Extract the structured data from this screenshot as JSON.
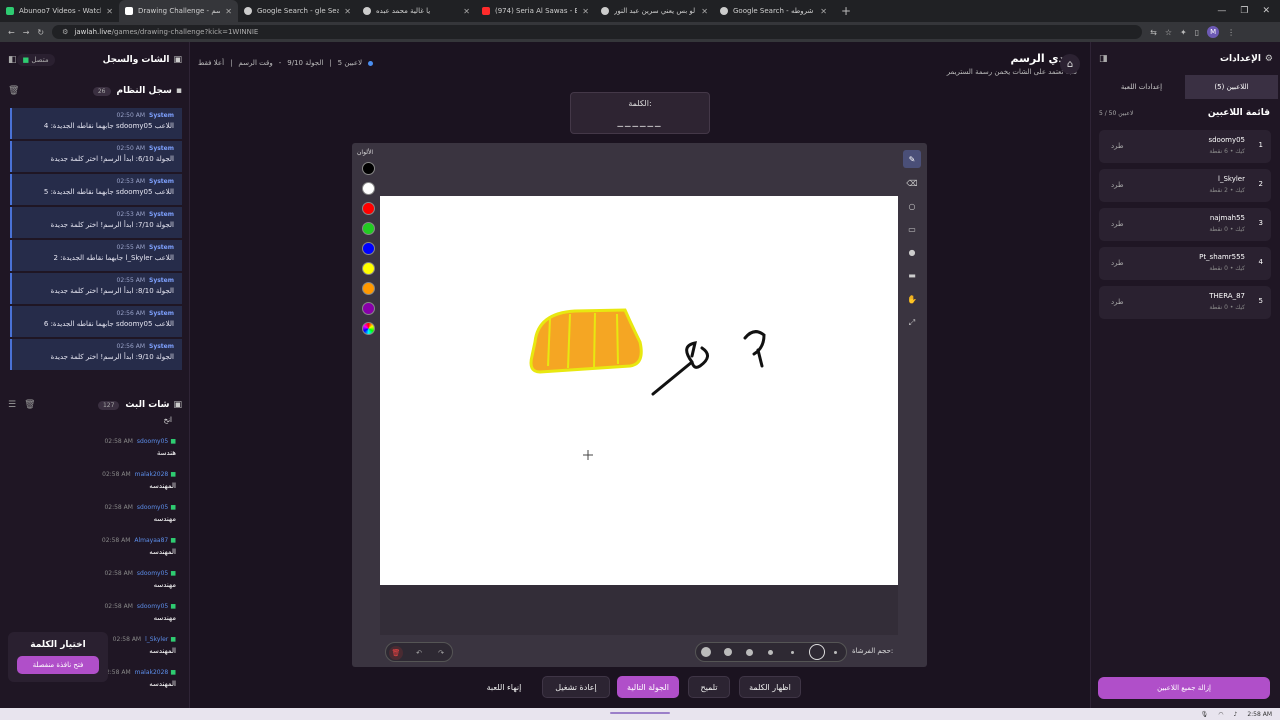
{
  "browser": {
    "tabs": [
      {
        "title": "Abunoo7 Videos - Watch On-D",
        "color": "#2ecc71"
      },
      {
        "title": "Drawing Challenge - تحدي الرسم",
        "color": "#ffffff"
      },
      {
        "title": "Google Search - gle Search",
        "color": "#cccccc"
      },
      {
        "title": "يا غالية محمد عبده",
        "color": "#cccccc"
      },
      {
        "title": "(974) Seria Al Sawas - Bas awa",
        "color": "#ff2b2b"
      },
      {
        "title": "لو بس يعني سرين عبد النور",
        "color": "#cccccc"
      },
      {
        "title": "Google Search - شروطه",
        "color": "#cccccc"
      }
    ],
    "url_host": "jawlah.live",
    "url_path": "/games/drawing-challenge?kick=1WINNIE"
  },
  "left": {
    "title": "الشات والسجل",
    "status": "متصل",
    "log_title": "سجل النظام",
    "log_count": "26",
    "log_entries": [
      {
        "time": "02:50 AM",
        "user": "System",
        "msg": "اللاعب sdoomy05 جابهما نقاطه الجديدة: 4"
      },
      {
        "time": "02:50 AM",
        "user": "System",
        "msg": "الجولة 6/10: ابدأ الرسم! اختر كلمة جديدة"
      },
      {
        "time": "02:53 AM",
        "user": "System",
        "msg": "اللاعب sdoomy05 جابهما نقاطه الجديدة: 5"
      },
      {
        "time": "02:53 AM",
        "user": "System",
        "msg": "الجولة 7/10: ابدأ الرسم! اختر كلمة جديدة"
      },
      {
        "time": "02:55 AM",
        "user": "System",
        "msg": "اللاعب l_Skyler جابهما نقاطه الجديدة: 2"
      },
      {
        "time": "02:55 AM",
        "user": "System",
        "msg": "الجولة 8/10: ابدأ الرسم! اختر كلمة جديدة"
      },
      {
        "time": "02:56 AM",
        "user": "System",
        "msg": "اللاعب sdoomy05 جابهما نقاطه الجديدة: 6"
      },
      {
        "time": "02:56 AM",
        "user": "System",
        "msg": "الجولة 9/10: ابدأ الرسم! اختر كلمة جديدة"
      }
    ],
    "chat_title": "شات البث",
    "chat_count": "127",
    "chat_trailing": "انخ",
    "chat": [
      {
        "time": "02:58 AM",
        "user": "sdoomy05",
        "msg": "هندسة"
      },
      {
        "time": "02:58 AM",
        "user": "malak2028",
        "msg": "المهندسه"
      },
      {
        "time": "02:58 AM",
        "user": "sdoomy05",
        "msg": "مهندسه"
      },
      {
        "time": "02:58 AM",
        "user": "Almayaa87",
        "msg": "المهندسه"
      },
      {
        "time": "02:58 AM",
        "user": "sdoomy05",
        "msg": "مهندسه"
      },
      {
        "time": "02:58 AM",
        "user": "sdoomy05",
        "msg": "مهندسه"
      },
      {
        "time": "02:58 AM",
        "user": "l_Skyler",
        "msg": "المهندسه"
      },
      {
        "time": "02:58 AM",
        "user": "malak2028",
        "msg": "المهندسه"
      }
    ],
    "pick_title": "اختيار الكلمة",
    "pick_button": "فتح نافذة منفصلة"
  },
  "center": {
    "game_title": "تحدي الرسم",
    "game_subtitle": "لعبة تعتمد على الشات يخمن رسمة الستريمر",
    "players_count": "5 لاعبين",
    "round_info": "الجولة 9/10",
    "time_info": "وقت الرسم",
    "mode": "أعلا فقط",
    "word_label": "الكلمة:",
    "word_mask": "______",
    "colors_label": "الألوان",
    "colors": [
      "#000000",
      "#ffffff",
      "#ff0000",
      "#22cc22",
      "#0000ff",
      "#ffff00",
      "#ff9900",
      "#8800aa"
    ],
    "brush_label": "حجم الفرشاة:",
    "buttons": {
      "end": "إنهاء اللعبة",
      "restart": "إعادة تشغيل",
      "next": "الجولة التالية",
      "hint": "تلميح",
      "reveal": "اظهار الكلمة"
    }
  },
  "right": {
    "title": "الإعدادات",
    "tab_players": "اللاعبين (5)",
    "tab_settings": "إعدادات اللعبة",
    "list_title": "قائمة اللاعبين",
    "list_count": "5 / 50 لاعبين",
    "kick_label": "طرد",
    "players": [
      {
        "rank": "1",
        "name": "sdoomy05",
        "sub": "كيك • 6 نقطة"
      },
      {
        "rank": "2",
        "name": "l_Skyler",
        "sub": "كيك • 2 نقطة"
      },
      {
        "rank": "3",
        "name": "najmah55",
        "sub": "كيك • 0 نقطة"
      },
      {
        "rank": "4",
        "name": "Pt_shamr555",
        "sub": "كيك • 0 نقطة"
      },
      {
        "rank": "5",
        "name": "THERA_87",
        "sub": "كيك • 0 نقطة"
      }
    ],
    "remove_all": "إزالة جميع اللاعبين"
  },
  "taskbar": {
    "time": "2:58 AM"
  }
}
